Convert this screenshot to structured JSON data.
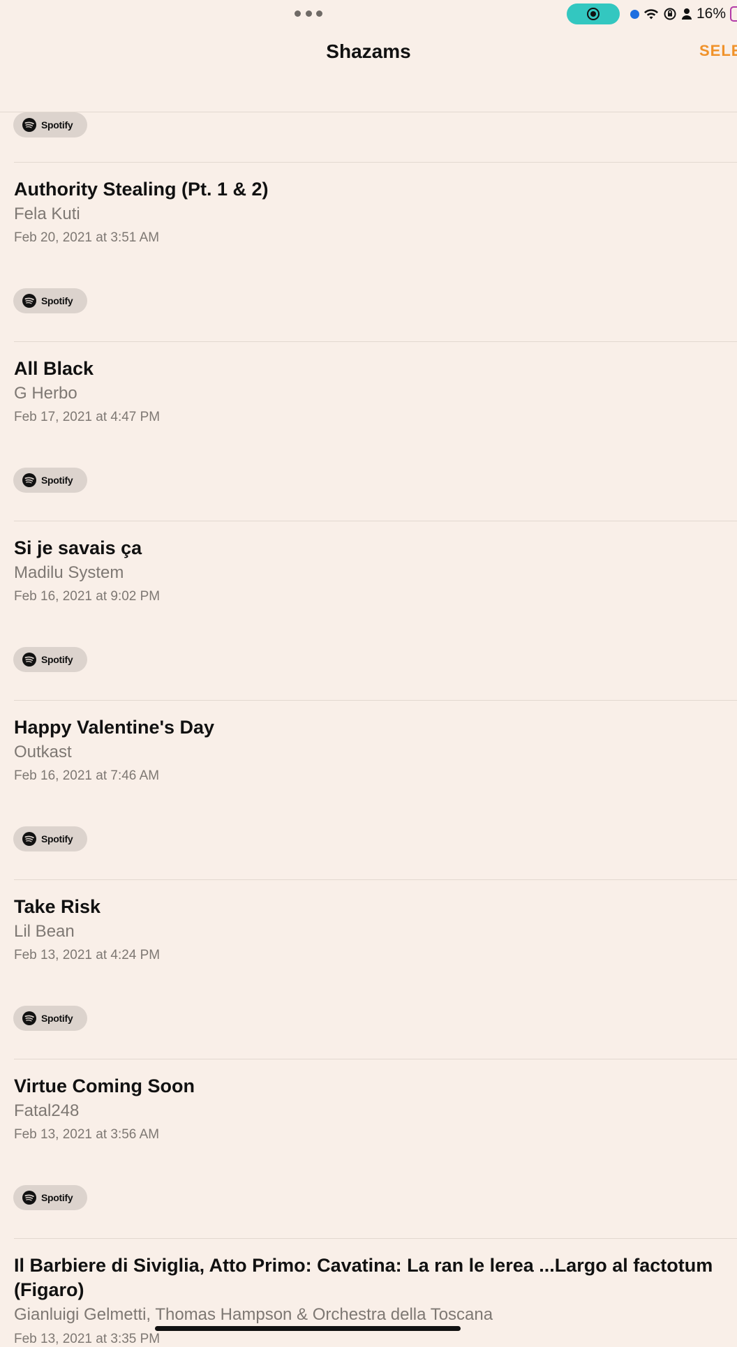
{
  "status_bar": {
    "battery_percent": "16%",
    "recording_color": "#33c7c0"
  },
  "nav": {
    "title": "Shazams",
    "select_label": "SELE"
  },
  "spotify_label": "Spotify",
  "songs": [
    {
      "title": "Authority Stealing (Pt. 1 & 2)",
      "artist": "Fela Kuti",
      "date": "Feb 20, 2021 at 3:51 AM"
    },
    {
      "title": "All Black",
      "artist": "G Herbo",
      "date": "Feb 17, 2021 at 4:47 PM"
    },
    {
      "title": "Si je savais ça",
      "artist": "Madilu System",
      "date": "Feb 16, 2021 at 9:02 PM"
    },
    {
      "title": "Happy Valentine's Day",
      "artist": "Outkast",
      "date": "Feb 16, 2021 at 7:46 AM"
    },
    {
      "title": "Take Risk",
      "artist": "Lil Bean",
      "date": "Feb 13, 2021 at 4:24 PM"
    },
    {
      "title": "Virtue Coming Soon",
      "artist": "Fatal248",
      "date": "Feb 13, 2021 at 3:56 AM"
    },
    {
      "title": "Il Barbiere di Siviglia, Atto Primo: Cavatina: La ran le lerea ...Largo al factotum (Figaro)",
      "artist": "Gianluigi Gelmetti, Thomas Hampson & Orchestra della Toscana",
      "date": "Feb 13, 2021 at 3:35 PM"
    }
  ],
  "colors": {
    "background": "#f9efe8",
    "accent": "#f0922a",
    "secondary_text": "#7e7873",
    "spotify_pill": "#dcd3cd"
  }
}
